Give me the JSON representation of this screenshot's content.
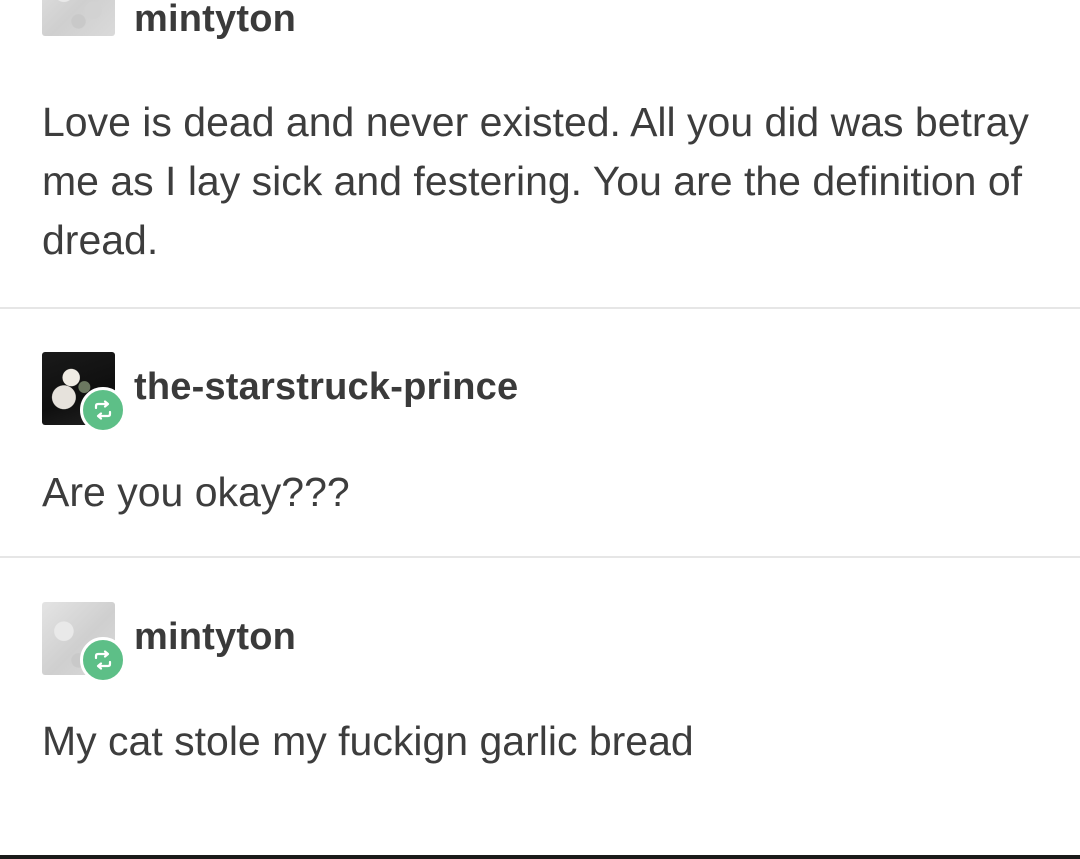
{
  "posts": [
    {
      "username": "mintyton",
      "text": "Love is dead and never existed. All you did was betray me as I lay sick and festering. You are the definition of dread.",
      "reblogged": false,
      "avatar": "pale-sketch-avatar"
    },
    {
      "username": "the-starstruck-prince",
      "text": "Are you okay???",
      "reblogged": true,
      "avatar": "dark-photo-avatar"
    },
    {
      "username": "mintyton",
      "text": "My cat stole my fuckign garlic bread",
      "reblogged": true,
      "avatar": "pale-sketch-avatar"
    }
  ],
  "icons": {
    "reblog": "reblog-icon"
  },
  "colors": {
    "reblog_badge": "#5dbf87",
    "text": "#3d3d3d",
    "username": "#3a3a3a",
    "divider": "#e6e6e6"
  }
}
